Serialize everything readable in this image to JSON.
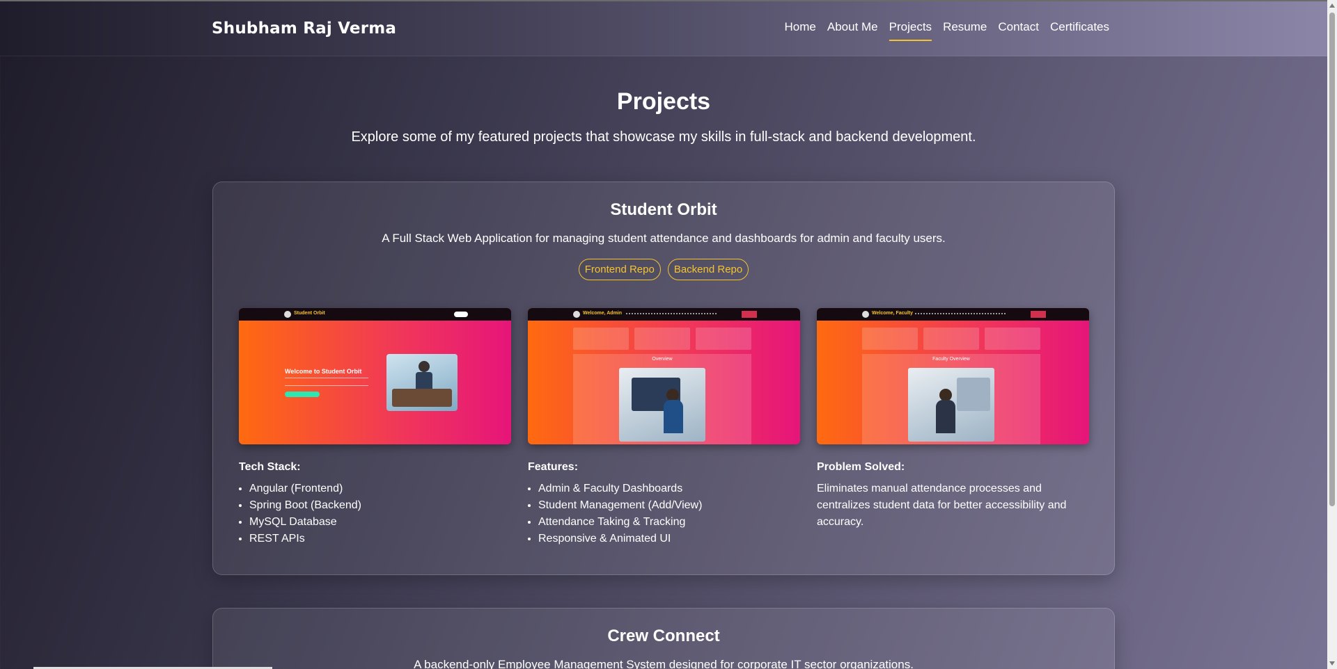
{
  "header": {
    "brand": "Shubham Raj Verma",
    "nav": [
      "Home",
      "About Me",
      "Projects",
      "Resume",
      "Contact",
      "Certificates"
    ],
    "active": "Projects"
  },
  "hero": {
    "title": "Projects",
    "subtitle": "Explore some of my featured projects that showcase my skills in full-stack and backend development."
  },
  "projects": [
    {
      "title": "Student Orbit",
      "description": "A Full Stack Web Application for managing student attendance and dashboards for admin and faculty users.",
      "repos": [
        "Frontend Repo",
        "Backend Repo"
      ],
      "screenshots": {
        "s1_brand": "Student Orbit",
        "s1_welcome": "Welcome to Student Orbit",
        "s2_title": "Welcome, Admin",
        "s2_overview": "Overview",
        "s3_title": "Welcome, Faculty",
        "s3_overview": "Faculty Overview"
      },
      "tech_heading": "Tech Stack:",
      "tech": [
        "Angular (Frontend)",
        "Spring Boot (Backend)",
        "MySQL Database",
        "REST APIs"
      ],
      "features_heading": "Features:",
      "features": [
        "Admin & Faculty Dashboards",
        "Student Management (Add/View)",
        "Attendance Taking & Tracking",
        "Responsive & Animated UI"
      ],
      "problem_heading": "Problem Solved:",
      "problem": "Eliminates manual attendance processes and centralizes student data for better accessibility and accuracy."
    },
    {
      "title": "Crew Connect",
      "description": "A backend-only Employee Management System designed for corporate IT sector organizations."
    }
  ],
  "colors": {
    "accent": "#f4c430",
    "screenshot_gradient_start": "#ff6a10",
    "screenshot_gradient_end": "#e6157a"
  }
}
